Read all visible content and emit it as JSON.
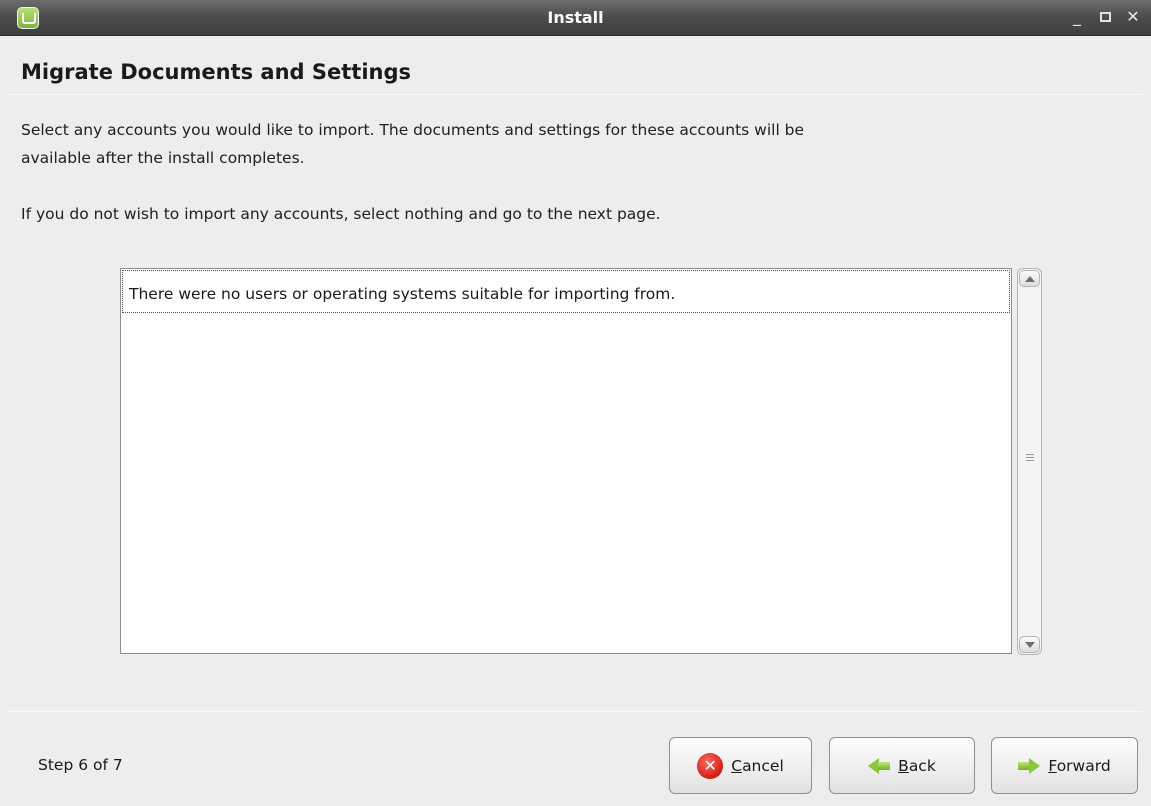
{
  "window": {
    "title": "Install",
    "icon": "linux-mint-icon",
    "controls": [
      "minimize",
      "maximize",
      "close"
    ]
  },
  "page": {
    "title": "Migrate Documents and Settings",
    "description": "Select any accounts you would like to import.  The documents and settings for these accounts will be",
    "description_line2": "available after the install completes.",
    "hint": "If you do not wish to import any accounts, select nothing and go to the next page."
  },
  "accounts_list": {
    "rows": [
      "There were no users or operating systems suitable for importing from."
    ]
  },
  "footer": {
    "step": "Step 6 of 7",
    "cancel": {
      "accel": "C",
      "rest": "ancel"
    },
    "back": {
      "accel": "B",
      "rest": "ack"
    },
    "forward": {
      "accel": "F",
      "rest": "orward"
    }
  }
}
